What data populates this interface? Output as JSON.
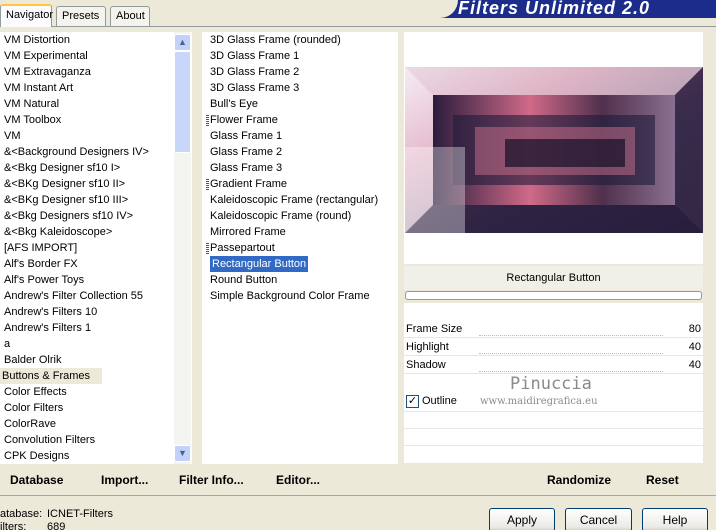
{
  "tabs": [
    {
      "label": "Navigator",
      "active": true
    },
    {
      "label": "Presets",
      "active": false
    },
    {
      "label": "About",
      "active": false
    }
  ],
  "banner_title": "Filters Unlimited 2.0",
  "categories": [
    "VM Distortion",
    "VM Experimental",
    "VM Extravaganza",
    "VM Instant Art",
    "VM Natural",
    "VM Toolbox",
    "VM",
    "&<Background Designers IV>",
    "&<Bkg Designer sf10 I>",
    "&<BKg Designer sf10 II>",
    "&<BKg Designer sf10 III>",
    "&<Bkg Designers sf10 IV>",
    "&<Bkg Kaleidoscope>",
    "[AFS IMPORT]",
    "Alf's Border FX",
    "Alf's Power Toys",
    "Andrew's Filter Collection 55",
    "Andrew's Filters 10",
    "Andrew's Filters 1",
    "a",
    "Balder Olrik",
    "Buttons & Frames",
    "Color Effects",
    "Color Filters",
    "ColorRave",
    "Convolution Filters",
    "CPK Designs"
  ],
  "selected_category": "Buttons & Frames",
  "filters": [
    {
      "label": "3D Glass Frame (rounded)",
      "folder": false
    },
    {
      "label": "3D Glass Frame 1",
      "folder": false
    },
    {
      "label": "3D Glass Frame 2",
      "folder": false
    },
    {
      "label": "3D Glass Frame 3",
      "folder": false
    },
    {
      "label": "Bull's Eye",
      "folder": false
    },
    {
      "label": "Flower Frame",
      "folder": true
    },
    {
      "label": "Glass Frame 1",
      "folder": false
    },
    {
      "label": "Glass Frame 2",
      "folder": false
    },
    {
      "label": "Glass Frame 3",
      "folder": false
    },
    {
      "label": "Gradient Frame",
      "folder": true
    },
    {
      "label": "Kaleidoscopic Frame (rectangular)",
      "folder": false
    },
    {
      "label": "Kaleidoscopic Frame (round)",
      "folder": false
    },
    {
      "label": "Mirrored Frame",
      "folder": false
    },
    {
      "label": "Passepartout",
      "folder": true
    },
    {
      "label": "Rectangular Button",
      "folder": false
    },
    {
      "label": "Round Button",
      "folder": false
    },
    {
      "label": "Simple Background Color Frame",
      "folder": false
    }
  ],
  "selected_filter": "Rectangular Button",
  "filter_title": "Rectangular Button",
  "params": [
    {
      "label": "Frame Size",
      "value": "80"
    },
    {
      "label": "Highlight",
      "value": "40"
    },
    {
      "label": "Shadow",
      "value": "40"
    }
  ],
  "outline": {
    "label": "Outline",
    "checked": true
  },
  "watermark": {
    "name": "Pinuccia",
    "url": "www.maidiregrafica.eu"
  },
  "bottom_buttons": {
    "database": "Database",
    "import": "Import...",
    "filter_info": "Filter Info...",
    "editor": "Editor...",
    "randomize": "Randomize",
    "reset": "Reset"
  },
  "status": {
    "database_label": "atabase:",
    "database_value": "ICNET-Filters",
    "filters_label": "ilters:",
    "filters_value": "689"
  },
  "dialog_buttons": {
    "apply": "Apply",
    "cancel": "Cancel",
    "help": "Help"
  },
  "colors": {
    "banner": "#1c2c8a",
    "selection_blue": "#316ac5",
    "window_bg": "#ece9d8"
  }
}
